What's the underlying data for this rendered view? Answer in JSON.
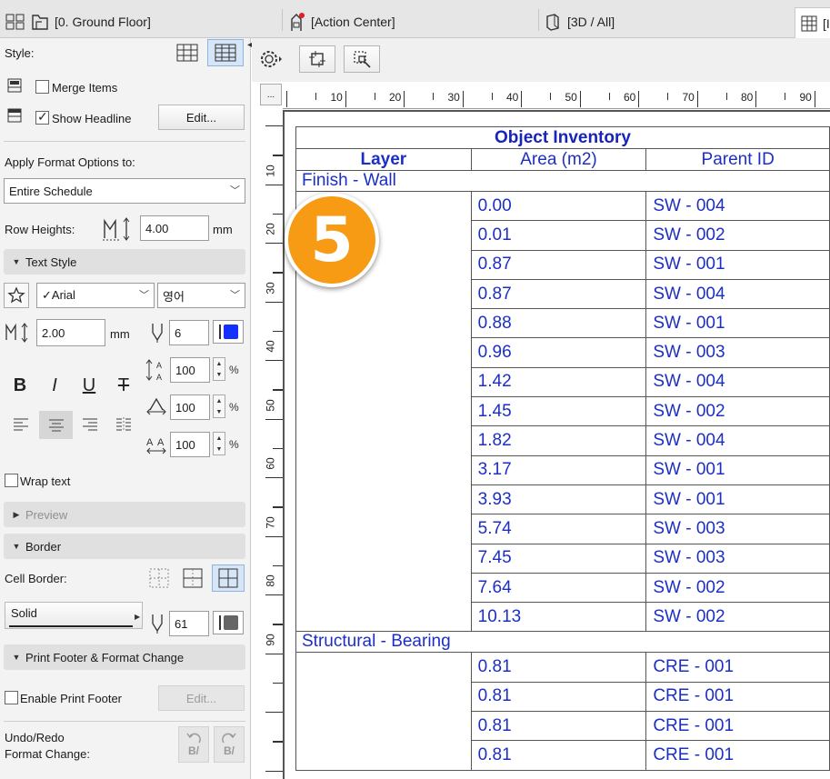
{
  "tabs": [
    {
      "label": "[0. Ground Floor]",
      "icon": "floor-plan-icon"
    },
    {
      "label": "[Action Center]",
      "icon": "action-center-icon"
    },
    {
      "label": "[3D / All]",
      "icon": "3d-view-icon"
    },
    {
      "label": "[IE",
      "icon": "schedule-table-icon"
    }
  ],
  "panel": {
    "style_label": "Style:",
    "merge_items_label": "Merge Items",
    "merge_items_checked": false,
    "show_headline_label": "Show Headline",
    "show_headline_checked": true,
    "edit_button": "Edit...",
    "apply_format_label": "Apply Format Options to:",
    "apply_format_value": "Entire Schedule",
    "row_heights_label": "Row Heights:",
    "row_heights_value": "4.00",
    "row_heights_unit": "mm",
    "text_style_section": "Text Style",
    "font_value": "✓Arial",
    "script_value": "영어",
    "text_size_value": "2.00",
    "text_size_unit": "mm",
    "pen_value": "6",
    "bold_label": "B",
    "italic_label": "I",
    "underline_label": "U",
    "strike_label": "T",
    "scale1_value": "100",
    "scale2_value": "100",
    "scale3_value": "100",
    "percent": "%",
    "wrap_text_label": "Wrap text",
    "wrap_text_checked": false,
    "preview_section": "Preview",
    "border_section": "Border",
    "cell_border_label": "Cell Border:",
    "line_type_value": "Solid",
    "border_pen_value": "61",
    "print_footer_section": "Print Footer & Format Change",
    "enable_print_footer_label": "Enable Print Footer",
    "enable_print_footer_checked": false,
    "footer_edit_button": "Edit...",
    "undo_redo_label_1": "Undo/Redo",
    "undo_redo_label_2": "Format Change:"
  },
  "ruler": {
    "h_numbers": [
      "10",
      "20",
      "30",
      "40",
      "50",
      "60",
      "70",
      "80",
      "90"
    ],
    "v_numbers": [
      "10",
      "20",
      "30",
      "40",
      "50",
      "60",
      "70",
      "80",
      "90"
    ],
    "corner_label": "..."
  },
  "schedule": {
    "title": "Object Inventory",
    "headers": [
      "Layer",
      "Area (m2)",
      "Parent ID"
    ],
    "groups": [
      {
        "name": "Finish - Wall",
        "rows": [
          [
            "0.00",
            "SW - 004"
          ],
          [
            "0.01",
            "SW - 002"
          ],
          [
            "0.87",
            "SW - 001"
          ],
          [
            "0.87",
            "SW - 004"
          ],
          [
            "0.88",
            "SW - 001"
          ],
          [
            "0.96",
            "SW - 003"
          ],
          [
            "1.42",
            "SW - 004"
          ],
          [
            "1.45",
            "SW - 002"
          ],
          [
            "1.82",
            "SW - 004"
          ],
          [
            "3.17",
            "SW - 001"
          ],
          [
            "3.93",
            "SW - 001"
          ],
          [
            "5.74",
            "SW - 003"
          ],
          [
            "7.45",
            "SW - 003"
          ],
          [
            "7.64",
            "SW - 002"
          ],
          [
            "10.13",
            "SW - 002"
          ]
        ]
      },
      {
        "name": "Structural - Bearing",
        "rows": [
          [
            "0.81",
            "CRE - 001"
          ],
          [
            "0.81",
            "CRE - 001"
          ],
          [
            "0.81",
            "CRE - 001"
          ],
          [
            "0.81",
            "CRE - 001"
          ]
        ]
      }
    ]
  },
  "callout": {
    "number": "5",
    "color": "#f79a14"
  },
  "colors": {
    "schedule_text": "#1c2fc4",
    "selection": "#d6e6f7",
    "pen_blue": "#1430ff"
  }
}
